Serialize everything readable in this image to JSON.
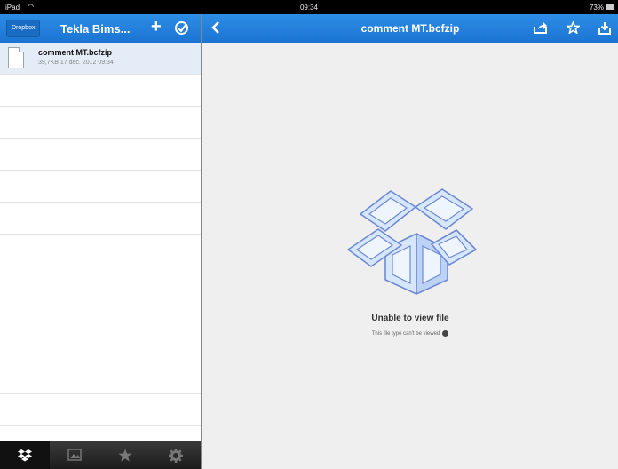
{
  "status_bar": {
    "carrier": "iPad",
    "time": "09:34",
    "battery": "73%"
  },
  "sidebar": {
    "dropbox_button": "Dropbox",
    "title": "Tekla Bims...",
    "add_label": "+",
    "files": [
      {
        "name": "comment MT.bcfzip",
        "meta": "39,7KB 17 dec. 2012 09:34"
      }
    ],
    "tabs": [
      "dropbox-icon",
      "photos-icon",
      "favorites-icon",
      "settings-icon"
    ]
  },
  "main": {
    "title": "comment MT.bcfzip",
    "message_title": "Unable to view file",
    "message_sub": "This file type can't be viewed"
  },
  "colors": {
    "header_blue": "#1b74d2",
    "sidebar_bg": "#ffffff",
    "content_bg": "#efefef",
    "tab_bar": "#222222"
  }
}
